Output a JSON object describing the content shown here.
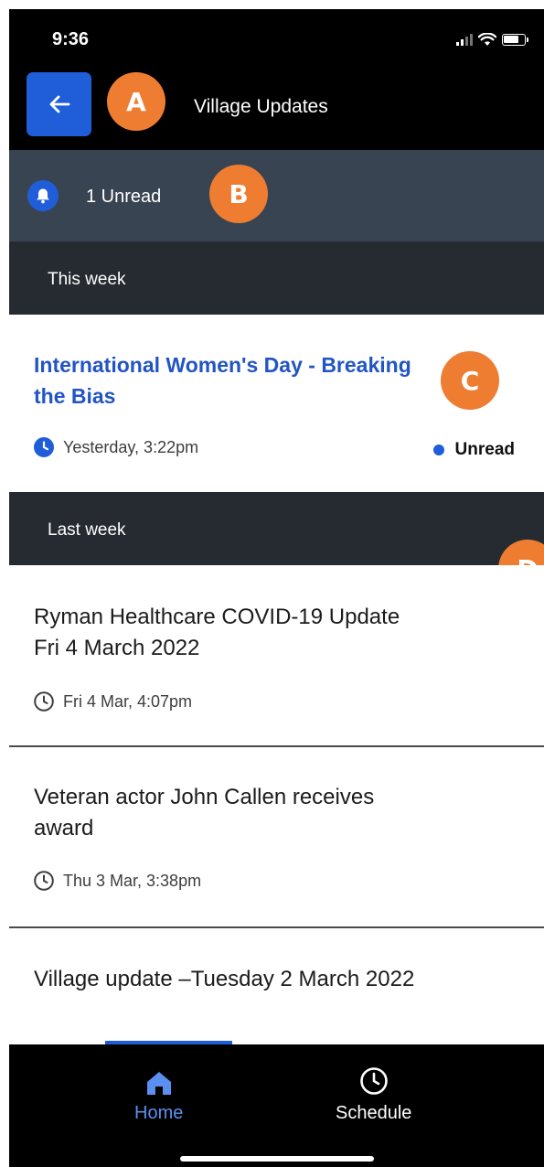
{
  "status_bar": {
    "time": "9:36"
  },
  "app_bar": {
    "title": "Village Updates"
  },
  "unread": {
    "label": "1 Unread"
  },
  "annotations": {
    "a": "A",
    "b": "B",
    "c": "C",
    "d": "D"
  },
  "sections": [
    {
      "label": "This week"
    },
    {
      "label": "Last week"
    }
  ],
  "updates": [
    {
      "title": "International Women's Day - Breaking the Bias",
      "time": "Yesterday, 3:22pm",
      "status": "Unread"
    },
    {
      "title": "Ryman Healthcare COVID-19 Update Fri 4 March 2022",
      "time": "Fri 4 Mar, 4:07pm"
    },
    {
      "title": "Veteran actor John Callen receives award",
      "time": "Thu 3 Mar, 3:38pm"
    },
    {
      "title": "Village update –Tuesday 2 March 2022"
    }
  ],
  "tab_bar": {
    "home": "Home",
    "schedule": "Schedule"
  },
  "colors": {
    "accent": "#1f5ed8",
    "annotation": "#ee7d31",
    "unread_bar": "#394452",
    "section_header": "#262b32",
    "tab_active": "#5b8ff0"
  }
}
